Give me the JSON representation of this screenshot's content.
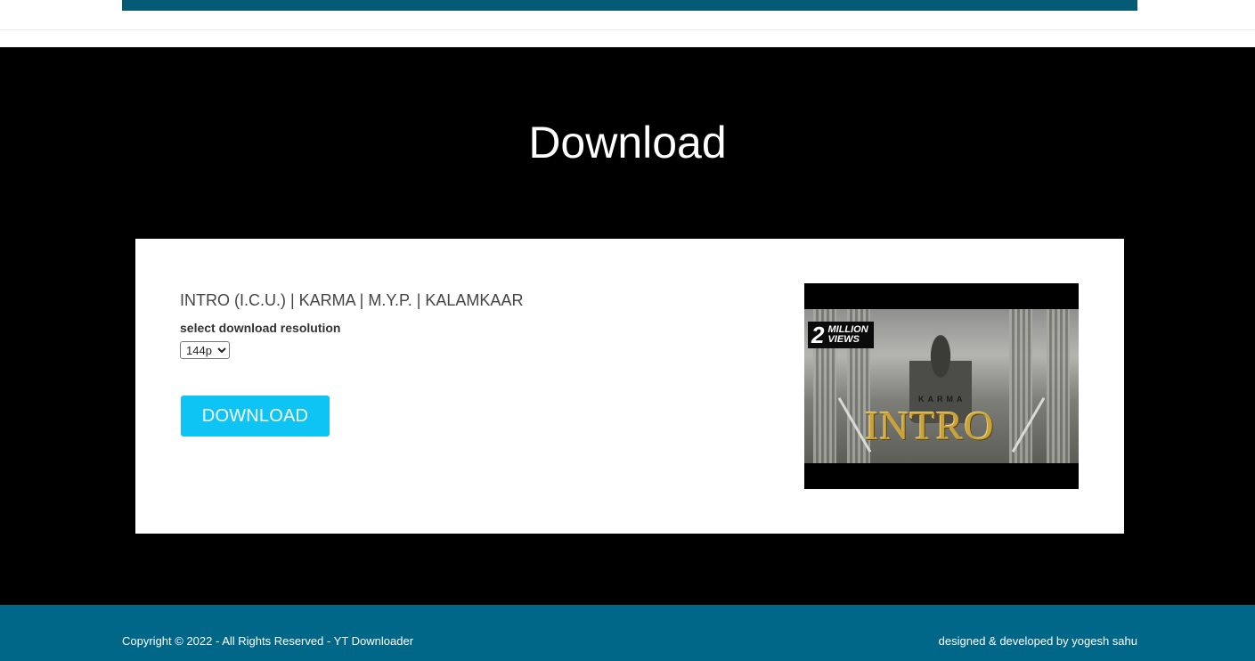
{
  "page": {
    "title": "Download"
  },
  "video": {
    "title": "INTRO (I.C.U.) | KARMA | M.Y.P. | KALAMKAAR",
    "resolution_label": "select download resolution",
    "resolution_selected": "144p",
    "resolution_options": [
      "144p"
    ],
    "download_label": "DOWNLOAD",
    "thumbnail": {
      "badge_number": "2",
      "badge_text_line1": "MILLION",
      "badge_text_line2": "VIEWS",
      "artist_text": "KARMA",
      "title_text": "INTRO"
    }
  },
  "footer": {
    "copyright": "Copyright © 2022 - All Rights Reserved - YT Downloader",
    "credit": "designed & developed by yogesh sahu"
  },
  "colors": {
    "topbar": "#055a75",
    "hero_bg": "#000000",
    "button": "#0ec4f5",
    "footer": "#006789"
  }
}
